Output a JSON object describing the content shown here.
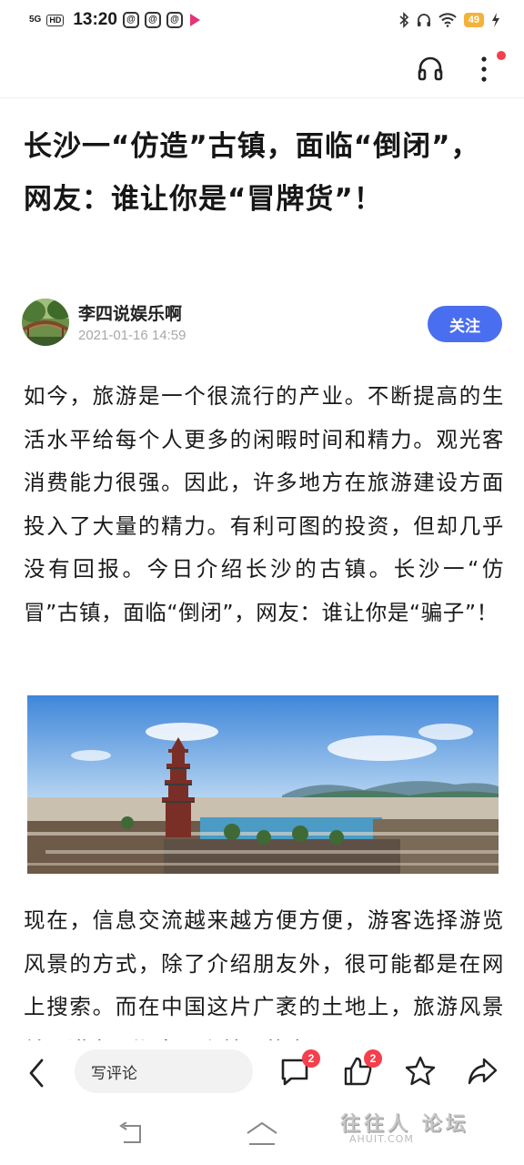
{
  "status_bar": {
    "signal": "5G",
    "hd": "HD",
    "time": "13:20",
    "app_icons": [
      "@",
      "@",
      "@"
    ],
    "battery": "49"
  },
  "article": {
    "title": "长沙一“仿造”古镇，面临“倒闭”，网友：谁让你是“冒牌货”！",
    "author": {
      "name": "李四说娱乐啊",
      "date": "2021-01-16 14:59",
      "follow_label": "关注"
    },
    "paragraphs": [
      "如今，旅游是一个很流行的产业。不断提高的生活水平给每个人更多的闲暇时间和精力。观光客消费能力很强。因此，许多地方在旅游建设方面投入了大量的精力。有利可图的投资，但却几乎没有回报。今日介绍长沙的古镇。长沙一“仿冒”古镇，面临“倒闭”，网友：谁让你是“骗子”！",
      "现在，信息交流越来越方便方便，游客选择游览风景的方式，除了介绍朋友外，很可能都是在网上搜索。而在中国这片广袤的土地上，旅游风景并不讲究，湖南是个美丽的省"
    ]
  },
  "bottom_bar": {
    "comment_placeholder": "写评论",
    "comment_count": "2",
    "like_count": "2"
  },
  "watermark": {
    "text": "往往人 论坛",
    "sub": "AHUIT.COM"
  },
  "colors": {
    "accent": "#4a6ef0",
    "badge": "#f43f4c"
  }
}
